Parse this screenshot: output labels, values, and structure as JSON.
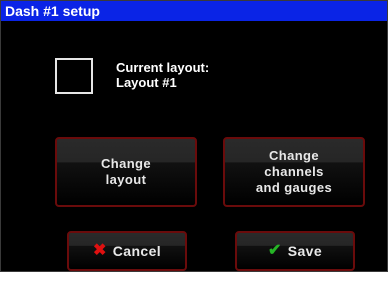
{
  "window": {
    "title": "Dash #1 setup"
  },
  "layout": {
    "current_label": "Current layout:",
    "current_value": "Layout #1"
  },
  "buttons": {
    "change_layout": [
      "Change",
      "layout"
    ],
    "change_channels": [
      "Change",
      "channels",
      "and gauges"
    ],
    "cancel": "Cancel",
    "save": "Save"
  },
  "icons": {
    "cancel": "close-icon",
    "save": "checkmark-icon"
  },
  "colors": {
    "titlebar": "#0a24e6",
    "button_border": "#6a0b0b",
    "cancel_icon": "#e01010",
    "save_icon": "#26b526"
  }
}
